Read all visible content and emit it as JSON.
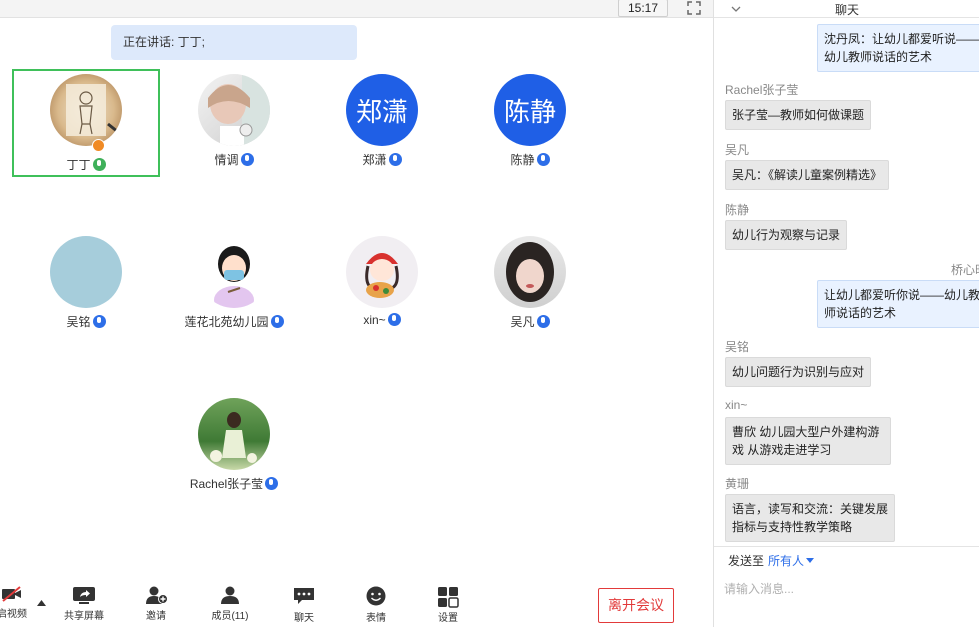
{
  "topbar": {
    "time": "15:17"
  },
  "speaking": {
    "text": "正在讲话: 丁丁;"
  },
  "participants": [
    {
      "name": "丁丁"
    },
    {
      "name": "情调"
    },
    {
      "name": "郑潇",
      "avatar_text": "郑潇"
    },
    {
      "name": "陈静",
      "avatar_text": "陈静"
    },
    {
      "name": "吴铭"
    },
    {
      "name": "莲花北苑幼儿园"
    },
    {
      "name": "xin~"
    },
    {
      "name": "吴凡"
    },
    {
      "name": "Rachel张子莹"
    }
  ],
  "toolbar": {
    "video": "启视频",
    "share": "共享屏幕",
    "invite": "邀请",
    "members": "成员(11)",
    "chat": "聊天",
    "emoji": "表情",
    "settings": "设置",
    "leave": "离开会议"
  },
  "chat": {
    "title": "聊天",
    "messages": [
      {
        "sender": "",
        "text": "沈丹凤：让幼儿都爱听说——\n幼儿教师说话的艺术"
      },
      {
        "sender": "Rachel张子莹",
        "text": "张子莹—教师如何做课题"
      },
      {
        "sender": "吴凡",
        "text": "吴凡：《解读儿童案例精选》"
      },
      {
        "sender": "陈静",
        "text": "幼儿行为观察与记录"
      },
      {
        "sender": "桥心时",
        "text": "让幼儿都爱听你说——幼儿教\n师说话的艺术"
      },
      {
        "sender": "吴铭",
        "text": "幼儿问题行为识别与应对"
      },
      {
        "sender": "xin~",
        "text": "曹欣  幼儿园大型户外建构游\n戏 从游戏走进学习"
      },
      {
        "sender": "黄珊",
        "text": "语言，读写和交流：关键发展\n指标与支持性教学策略"
      }
    ],
    "send_to_label": "发送至",
    "recipient": "所有人",
    "input_placeholder": "请输入消息..."
  },
  "colors": {
    "accent": "#2d6ee8",
    "active_border": "#3fc05a",
    "leave": "#e23a3a",
    "speaking_bg": "#dde9fb"
  }
}
